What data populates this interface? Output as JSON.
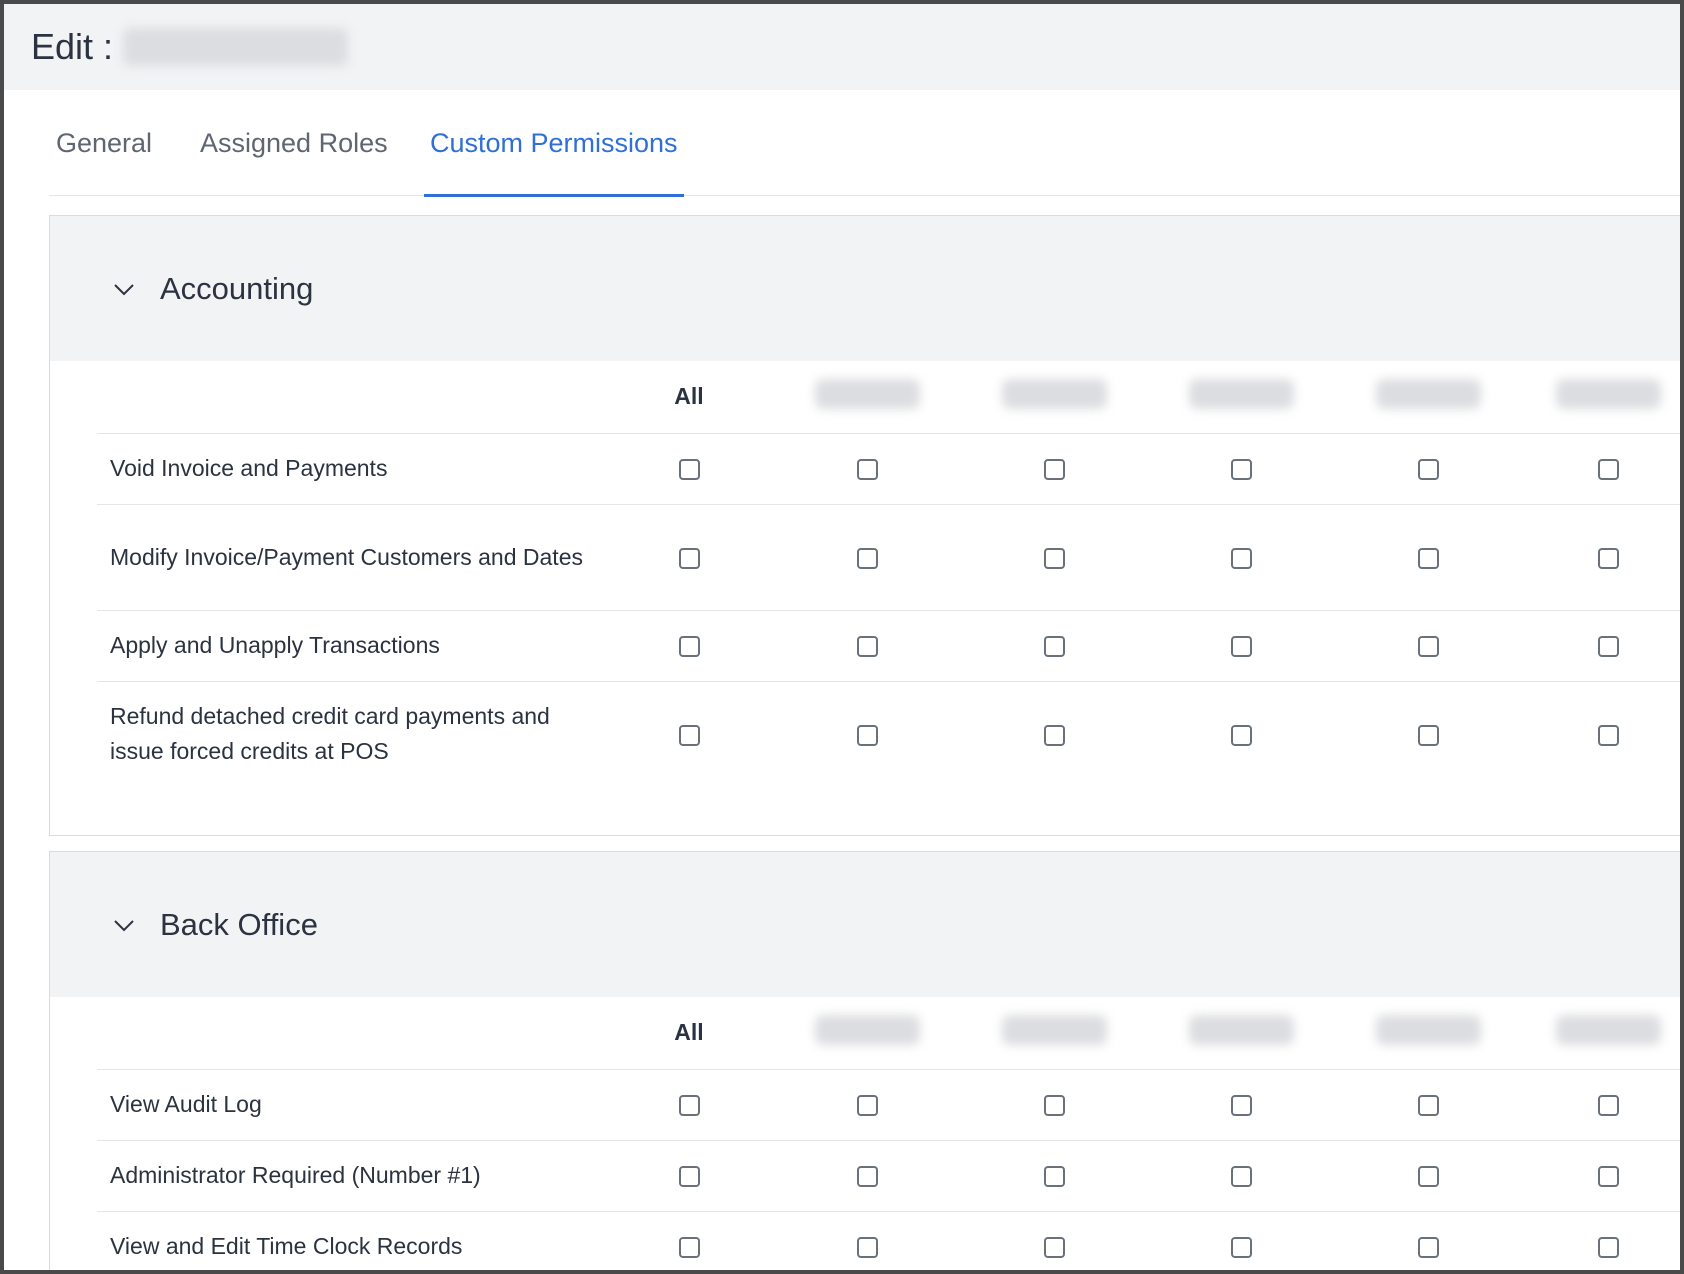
{
  "header": {
    "title": "Edit :"
  },
  "tabs": [
    {
      "label": "General"
    },
    {
      "label": "Assigned Roles"
    },
    {
      "label": "Custom Permissions"
    }
  ],
  "sections": [
    {
      "name": "Accounting",
      "all_label": "All",
      "rows": [
        "Void Invoice and Payments",
        "Modify Invoice/Payment Customers and Dates",
        "Apply and Unapply Transactions",
        "Refund detached credit card payments and issue forced credits at POS"
      ]
    },
    {
      "name": "Back Office",
      "all_label": "All",
      "rows": [
        "View Audit Log",
        "Administrator Required (Number #1)",
        "View and Edit Time Clock Records"
      ]
    }
  ],
  "icons": {
    "collapse": "chevron-down-icon"
  },
  "colors": {
    "accent": "#2f6fd6",
    "header_bg": "#f2f3f5",
    "text": "#2b3340"
  }
}
